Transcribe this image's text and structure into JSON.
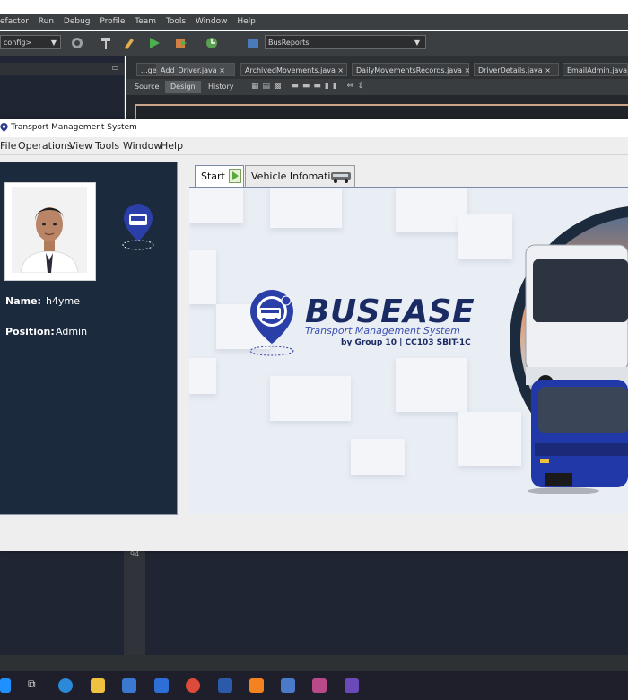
{
  "ide": {
    "menu": [
      "efactor",
      "Run",
      "Debug",
      "Profile",
      "Team",
      "Tools",
      "Window",
      "Help"
    ],
    "config_combo": "config>",
    "reports_combo": "BusReports",
    "file_tabs": [
      "...ge",
      "Add_Driver.java",
      "ArchivedMovements.java",
      "DailyMovementsRecords.java",
      "DriverDetails.java",
      "EmailAdmin.java"
    ],
    "view_tabs": [
      "Source",
      "Design",
      "History"
    ],
    "gutter_mark": "94"
  },
  "app": {
    "title": "Transport Management System",
    "menu": [
      "File",
      "Operations",
      "View",
      "Tools",
      "Window",
      "Help"
    ],
    "user": {
      "name_label": "Name:",
      "name_value": "h4yme",
      "position_label": "Position:",
      "position_value": "Admin"
    },
    "tabs": [
      {
        "label": "Start",
        "icon": "play-icon"
      },
      {
        "label": "Vehicle Infomation",
        "icon": "bus-icon"
      }
    ],
    "brand": {
      "logo_text": "BUSEASE",
      "title": "BUSEASE",
      "subtitle": "Transport Management System",
      "credit": "by Group 10 | CC103 SBIT-1C"
    }
  },
  "colors": {
    "sidebar": "#1c2a3e",
    "brand_navy": "#1a2a63",
    "brand_blue": "#3b4fb2",
    "content_bg": "#e9edf4"
  },
  "taskbar": [
    "windows-start-icon",
    "task-view-icon",
    "edge-icon",
    "file-explorer-icon",
    "store-icon",
    "mail-icon",
    "chrome-icon",
    "word-icon",
    "xampp-icon",
    "virtualbox-icon",
    "winrar-icon",
    "netbeans-icon"
  ]
}
